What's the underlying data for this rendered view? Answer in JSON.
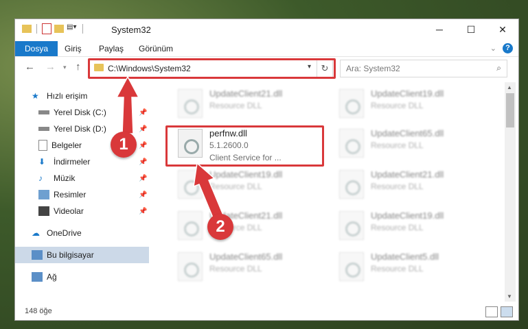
{
  "window": {
    "title": "System32"
  },
  "ribbon": {
    "tabs": [
      "Dosya",
      "Giriş",
      "Paylaş",
      "Görünüm"
    ]
  },
  "address": {
    "path": "C:\\Windows\\System32"
  },
  "search": {
    "placeholder": "Ara: System32"
  },
  "sidebar": {
    "items": [
      {
        "label": "Hızlı erişim"
      },
      {
        "label": "Yerel Disk (C:)"
      },
      {
        "label": "Yerel Disk (D:)"
      },
      {
        "label": "Belgeler"
      },
      {
        "label": "İndirmeler"
      },
      {
        "label": "Müzik"
      },
      {
        "label": "Resimler"
      },
      {
        "label": "Videolar"
      },
      {
        "label": "OneDrive"
      },
      {
        "label": "Bu bilgisayar"
      },
      {
        "label": "Ağ"
      }
    ]
  },
  "files": {
    "highlight": {
      "name": "perfnw.dll",
      "version": "5.1.2600.0",
      "desc": "Client Service for ..."
    },
    "blurred": [
      {
        "name": "UpdateClient21.dll",
        "desc": "Resource DLL"
      },
      {
        "name": "UpdateClient19.dll",
        "desc": "Resource DLL"
      },
      {
        "name": "UpdateClient65.dll",
        "desc": "Resource DLL"
      },
      {
        "name": "UpdateClient19.dll",
        "desc": "Resource DLL"
      },
      {
        "name": "UpdateClient21.dll",
        "desc": "Resource DLL"
      },
      {
        "name": "UpdateClient21.dll",
        "desc": "Resource DLL"
      },
      {
        "name": "UpdateClient19.dll",
        "desc": "Resource DLL"
      },
      {
        "name": "UpdateClient65.dll",
        "desc": "Resource DLL"
      },
      {
        "name": "UpdateClient5.dll",
        "desc": "Resource DLL"
      }
    ]
  },
  "status": {
    "count": "148 öğe"
  },
  "callouts": [
    "1",
    "2"
  ],
  "colors": {
    "accent": "#1979ca",
    "highlight_box": "#d9383a"
  }
}
